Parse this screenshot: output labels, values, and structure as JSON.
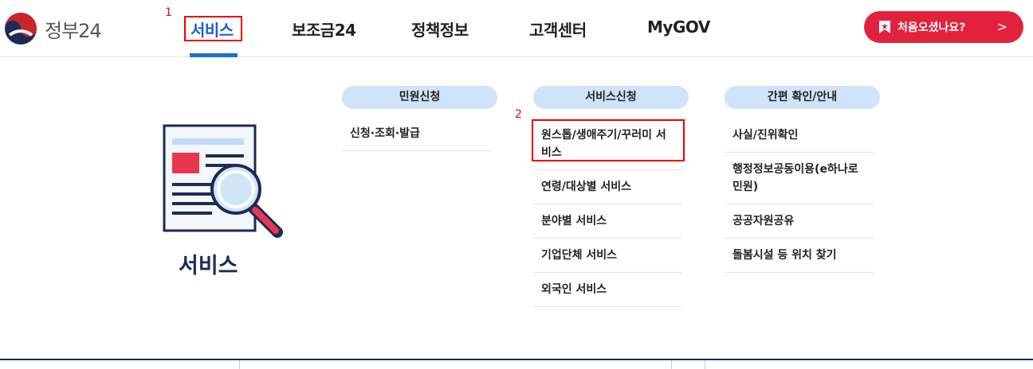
{
  "header": {
    "logo_text": "정부24",
    "nav": [
      "서비스",
      "보조금24",
      "정책정보",
      "고객센터",
      "MyGOV"
    ],
    "cta_label": "처음오셨나요?",
    "cta_chevron": ">"
  },
  "annotations": {
    "first": "1",
    "second": "2"
  },
  "hero": {
    "title": "서비스"
  },
  "columns": [
    {
      "title": "민원신청",
      "items": [
        "신청·조회·발급"
      ]
    },
    {
      "title": "서비스신청",
      "items": [
        "원스톱/생애주기/꾸러미 서비스",
        "연령/대상별 서비스",
        "분야별 서비스",
        "기업단체 서비스",
        "외국인 서비스"
      ]
    },
    {
      "title": "간편 확인/안내",
      "items": [
        "사실/진위확인",
        "행정정보공동이용(e하나로민원)",
        "공공자원공유",
        "돌봄시설 등 위치 찾기"
      ]
    }
  ],
  "colors": {
    "brand_blue": "#1a5fd0",
    "brand_red": "#e2223d",
    "pill_bg": "#cfe3fb",
    "navy": "#1d2a57"
  }
}
